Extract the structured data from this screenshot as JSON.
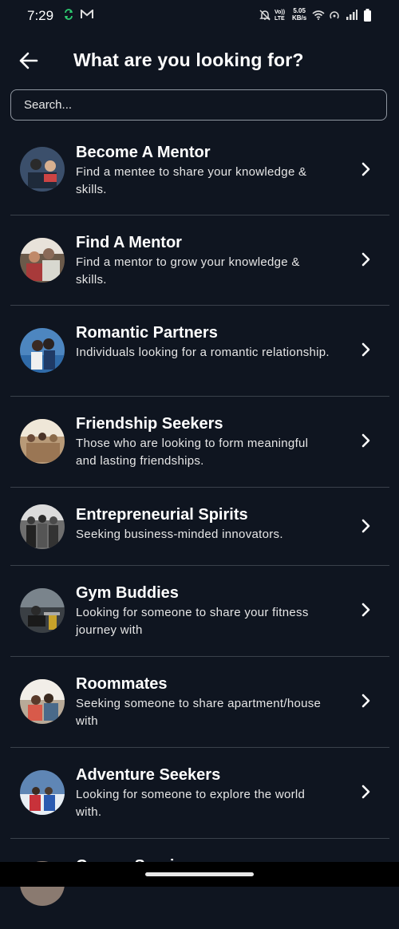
{
  "status_bar": {
    "time": "7:29",
    "network_speed_top": "5.05",
    "network_speed_bottom": "KB/s",
    "volte_top": "Vo))",
    "volte_bottom": "LTE"
  },
  "header": {
    "title": "What are you looking for?"
  },
  "search": {
    "placeholder": "Search..."
  },
  "items": [
    {
      "title": "Become A Mentor",
      "description": "Find a mentee to share your knowledge & skills.",
      "avatar_color": "#3b4f6b"
    },
    {
      "title": "Find A Mentor",
      "description": "Find a mentor to grow your knowledge & skills.",
      "avatar_color": "#6b5a4a"
    },
    {
      "title": "Romantic Partners",
      "description": "Individuals looking for a romantic relationship.",
      "avatar_color": "#4d86c0"
    },
    {
      "title": "Friendship Seekers",
      "description": "Those who are looking to form meaningful and lasting friendships.",
      "avatar_color": "#b89a78"
    },
    {
      "title": "Entrepreneurial Spirits",
      "description": "Seeking business-minded innovators.",
      "avatar_color": "#6e6e6e"
    },
    {
      "title": "Gym Buddies",
      "description": "Looking for someone to share your fitness journey with",
      "avatar_color": "#3a3f44"
    },
    {
      "title": "Roommates",
      "description": "Seeking someone to share apartment/house with",
      "avatar_color": "#b8aa98"
    },
    {
      "title": "Adventure Seekers",
      "description": "Looking for someone to explore the world with.",
      "avatar_color": "#5f86b5"
    },
    {
      "title": "Cancer Survivors",
      "description": "",
      "avatar_color": "#8a7a70"
    }
  ],
  "colors": {
    "background": "#0f1520",
    "divider": "#3a414b",
    "text": "#ffffff"
  }
}
